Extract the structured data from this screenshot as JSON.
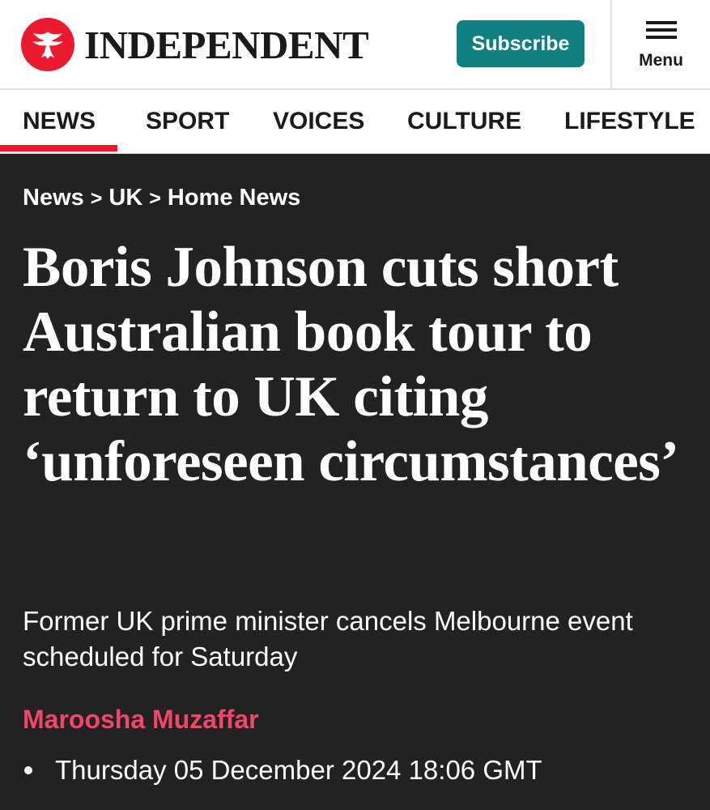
{
  "header": {
    "brand": "INDEPENDENT",
    "subscribe_label": "Subscribe",
    "menu_label": "Menu",
    "colors": {
      "brand_red": "#ec1a2e",
      "subscribe_teal": "#0f7f82"
    },
    "icons": {
      "logo": "eagle-logo-icon",
      "menu": "hamburger-menu-icon"
    }
  },
  "nav": {
    "items": [
      {
        "label": "NEWS",
        "active": true
      },
      {
        "label": "SPORT",
        "active": false
      },
      {
        "label": "VOICES",
        "active": false
      },
      {
        "label": "CULTURE",
        "active": false
      },
      {
        "label": "LIFESTYLE",
        "active": false
      }
    ]
  },
  "article": {
    "breadcrumb": [
      "News",
      "UK",
      "Home News"
    ],
    "breadcrumb_separator": ">",
    "headline": "Boris Johnson cuts short Australian book tour to return to UK citing ‘unforeseen circumstances’",
    "standfirst": "Former UK prime minister cancels Melbourne event scheduled for Saturday",
    "author": "Maroosha Muzaffar",
    "date": "Thursday 05 December 2024 18:06 GMT",
    "colors": {
      "background": "#222223",
      "author": "#f0466a"
    }
  }
}
